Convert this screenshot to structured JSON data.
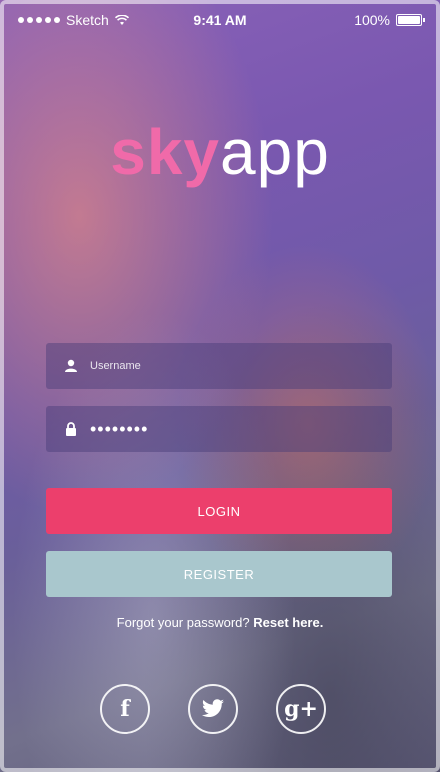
{
  "status_bar": {
    "carrier": "Sketch",
    "time": "9:41 AM",
    "battery": "100%"
  },
  "logo": {
    "part1": "sky",
    "part2": "app",
    "part1_color": "#f06aa9",
    "part2_color": "#ffffff"
  },
  "form": {
    "username_placeholder": "Username",
    "password_value": "••••••••"
  },
  "buttons": {
    "login_label": "LOGIN",
    "register_label": "REGISTER",
    "login_color": "#ec3f6c",
    "register_color": "#a9c7cd"
  },
  "forgot": {
    "prefix": "Forgot your password?",
    "link": "Reset here."
  },
  "social": {
    "facebook_glyph": "f",
    "googleplus_glyph": "g+",
    "icons": [
      "facebook-icon",
      "twitter-icon",
      "google-plus-icon"
    ]
  }
}
